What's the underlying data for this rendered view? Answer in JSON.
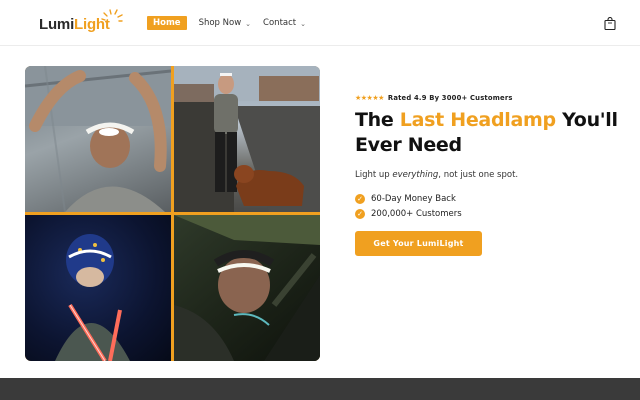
{
  "brand": {
    "name_part1": "Lumi",
    "name_part2": "Light",
    "accent_color": "#f0a020"
  },
  "nav": {
    "items": [
      {
        "label": "Home",
        "active": true
      },
      {
        "label": "Shop Now",
        "has_dropdown": true
      },
      {
        "label": "Contact",
        "has_dropdown": true
      }
    ],
    "cart_icon": "shopping-bag-icon"
  },
  "hero": {
    "rating_stars": "★★★★★",
    "rating_text": "Rated 4.9 By 3000+ Customers",
    "headline_part1": "The ",
    "headline_accent": "Last Headlamp",
    "headline_part2": " You'll Ever Need",
    "sub_part1": "Light up ",
    "sub_em": "everything",
    "sub_part2": ", not just one spot.",
    "bullets": [
      {
        "icon": "check-circle-icon",
        "text": "60-Day Money Back"
      },
      {
        "icon": "check-circle-icon",
        "text": "200,000+ Customers"
      }
    ],
    "cta_label": "Get Your LumiLight"
  }
}
